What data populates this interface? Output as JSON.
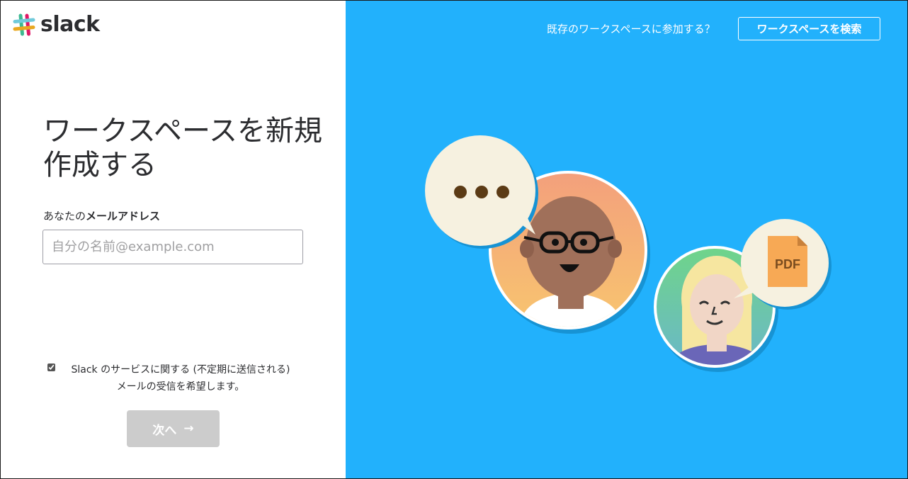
{
  "brand": {
    "name": "slack"
  },
  "left": {
    "title": "ワークスペースを新規作成する",
    "email_label_prefix": "あなたの",
    "email_label_bold": "メールアドレス",
    "email_placeholder": "自分の名前@example.com",
    "email_value": "",
    "consent_line1": "Slack のサービスに関する (不定期に送信される)",
    "consent_line2": "メールの受信を希望します。",
    "consent_checked": true,
    "next_label": "次へ",
    "next_arrow": "→"
  },
  "right": {
    "join_text": "既存のワークスペースに参加する？",
    "find_button": "ワークスペースを検索",
    "bubble_dots": "• • •",
    "pdf_label": "PDF"
  },
  "colors": {
    "panel_blue": "#22b1fc",
    "button_disabled": "#cccccc",
    "bubble_cream": "#f6f1e0",
    "pdf_orange": "#f7a955"
  }
}
